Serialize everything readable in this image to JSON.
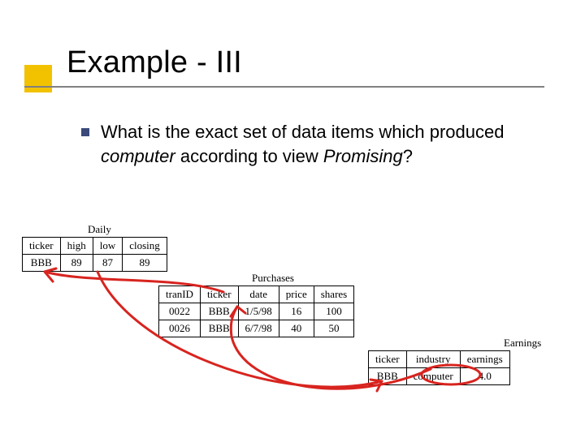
{
  "title": "Example - III",
  "bullet": {
    "prefix": "What is the exact set of data items which produced ",
    "word1": "computer",
    "mid": " according to view ",
    "word2": "Promising",
    "suffix": "?"
  },
  "tables": {
    "daily": {
      "label": "Daily",
      "headers": [
        "ticker",
        "high",
        "low",
        "closing"
      ],
      "row": [
        "BBB",
        "89",
        "87",
        "89"
      ]
    },
    "purchases": {
      "label": "Purchases",
      "headers": [
        "tranID",
        "ticker",
        "date",
        "price",
        "shares"
      ],
      "rows": [
        [
          "0022",
          "BBB",
          "1/5/98",
          "16",
          "100"
        ],
        [
          "0026",
          "BBB",
          "6/7/98",
          "40",
          "50"
        ]
      ]
    },
    "earnings": {
      "label": "Earnings",
      "headers": [
        "ticker",
        "industry",
        "earnings"
      ],
      "row": [
        "BBB",
        "computer",
        "4.0"
      ]
    }
  }
}
